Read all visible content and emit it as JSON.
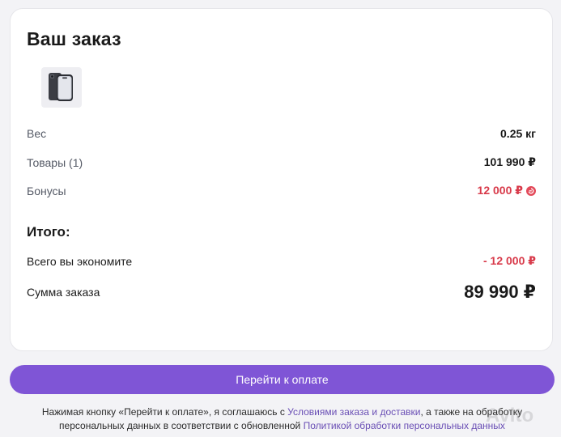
{
  "order": {
    "title": "Ваш заказ",
    "rows": {
      "weight": {
        "label": "Вес",
        "value": "0.25 кг"
      },
      "goods": {
        "label": "Товары (1)",
        "value": "101 990 ₽"
      },
      "bonus": {
        "label": "Бонусы",
        "value": "12 000 ₽"
      }
    },
    "totals": {
      "heading": "Итого:",
      "savings": {
        "label": "Всего вы экономите",
        "value": "- 12 000 ₽"
      },
      "sum": {
        "label": "Сумма заказа",
        "value": "89 990 ₽"
      }
    }
  },
  "actions": {
    "pay_label": "Перейти к оплате"
  },
  "legal": {
    "text1": "Нажимая кнопку «Перейти к оплате», я соглашаюсь с ",
    "link1": "Условиями заказа и доставки",
    "text2": ", а также на обработку персональных данных в соответствии с обновленной ",
    "link2": "Политикой обработки персональных данных"
  },
  "icons": {
    "product": "smartphone-image",
    "bonus": "bonus-icon"
  },
  "watermark": "Avito",
  "colors": {
    "accent": "#7f55d6",
    "discount": "#d83a4a",
    "link": "#6a4fb5"
  }
}
